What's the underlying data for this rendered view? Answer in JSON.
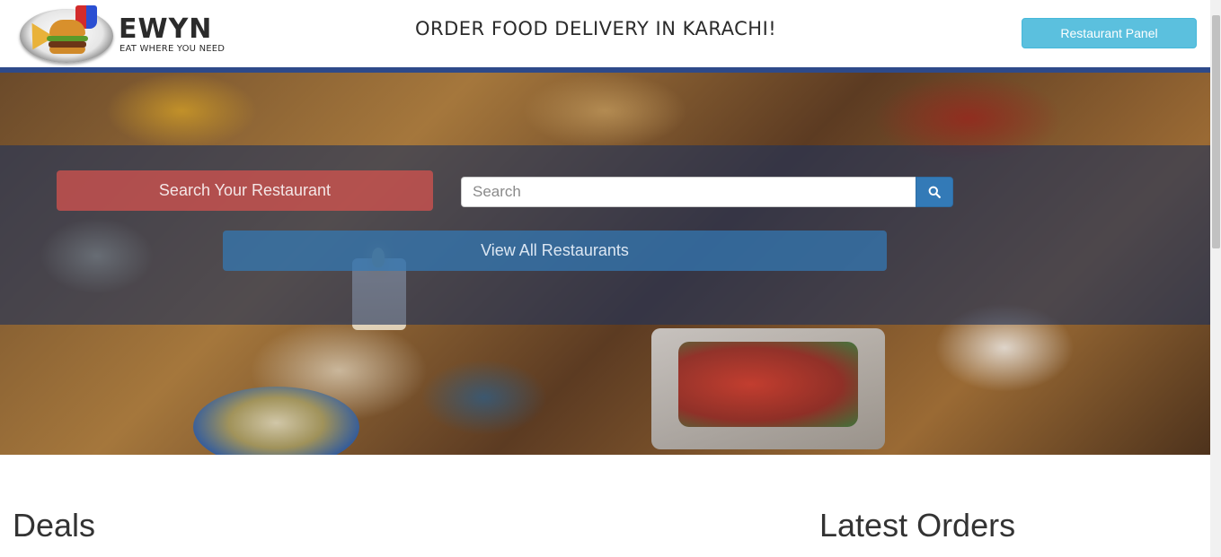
{
  "header": {
    "logo_name": "EWYN",
    "logo_tagline": "EAT WHERE YOU NEED",
    "headline": "ORDER FOOD DELIVERY IN KARACHI!",
    "restaurant_panel_label": "Restaurant Panel"
  },
  "hero": {
    "search_label": "Search Your Restaurant",
    "search_placeholder": "Search",
    "search_value": "",
    "view_all_label": "View All Restaurants"
  },
  "sections": {
    "deals_title": "Deals",
    "latest_orders_title": "Latest Orders"
  },
  "colors": {
    "header_bar": "#2e4a8a",
    "restaurant_panel_button": "#5bc0de",
    "search_label_button": "#d9534f",
    "search_button": "#337ab7",
    "view_all_button": "#337ab7"
  },
  "icons": {
    "search_button": "search-icon"
  }
}
